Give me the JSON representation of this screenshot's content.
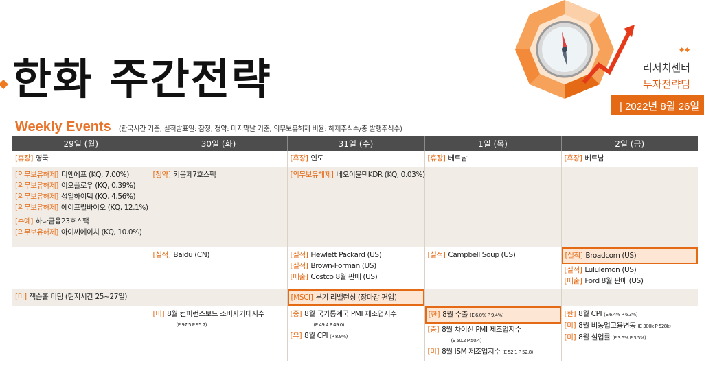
{
  "header": {
    "title": "한화 주간전략",
    "org_line1": "리서치센터",
    "org_line2": "투자전략팀",
    "date": "| 2022년 8월 26일",
    "section_title": "Weekly Events",
    "section_note": "(한국시간 기준, 실적발표일: 잠정, 청약: 마지막날 기준, 의무보유해제 비율: 해제주식수/총 발행주식수)",
    "accent": "#e46a15"
  },
  "days": [
    "29일 (월)",
    "30일 (화)",
    "31일 (수)",
    "1일 (목)",
    "2일 (금)"
  ],
  "rows": {
    "holiday": {
      "mon": {
        "tag": "[휴장]",
        "text": "영국"
      },
      "wed": {
        "tag": "[휴장]",
        "text": "인도"
      },
      "thu": {
        "tag": "[휴장]",
        "text": "베트남"
      },
      "fri": {
        "tag": "[휴장]",
        "text": "베트남"
      }
    },
    "ipo": {
      "mon": [
        {
          "tag": "[의무보유해제]",
          "text": "디앤에프 (KQ, 7.00%)"
        },
        {
          "tag": "[의무보유해제]",
          "text": "이오플로우 (KQ, 0.39%)"
        },
        {
          "tag": "[의무보유해제]",
          "text": "성일하이텍 (KQ, 4.56%)"
        },
        {
          "tag": "[의무보유해제]",
          "text": "에이프릴바이오 (KQ, 12.1%)"
        },
        {
          "tag": "[수예]",
          "text": "하나금융23호스팩"
        },
        {
          "tag": "[의무보유해제]",
          "text": "아이씨에이치 (KQ, 10.0%)"
        }
      ],
      "tue": {
        "tag": "[청약]",
        "text": "키움제7호스팩"
      },
      "wed": {
        "tag": "[의무보유해제]",
        "text": "네오이뮨텍KDR (KQ, 0.03%)"
      }
    },
    "earnings": {
      "tue": {
        "tag": "[실적]",
        "text": "Baidu (CN)"
      },
      "wed": [
        {
          "tag": "[실적]",
          "text": "Hewlett Packard (US)"
        },
        {
          "tag": "[실적]",
          "text": "Brown-Forman (US)"
        },
        {
          "tag": "[매출]",
          "text": "Costco 8월 판매 (US)"
        }
      ],
      "thu": {
        "tag": "[실적]",
        "text": "Campbell Soup (US)"
      },
      "fri": [
        {
          "tag": "[실적]",
          "text": "Broadcom (US)"
        },
        {
          "tag": "[실적]",
          "text": "Lululemon (US)"
        },
        {
          "tag": "[매출]",
          "text": "Ford 8월 판매 (US)"
        }
      ]
    },
    "events": {
      "mon": {
        "tag": "[미]",
        "text": "잭슨홀 미팅 (현지시간 25~27일)"
      },
      "wed": {
        "tag": "[MSCI]",
        "text": "분기 리밸런싱 (장마감 편입)"
      }
    },
    "macro": {
      "tue": [
        {
          "tag": "[미]",
          "text": "8월 컨퍼런스보드 소비자기대지수",
          "detail": "(E 97.5 P 95.7)"
        }
      ],
      "wed": [
        {
          "tag": "[중]",
          "text": "8월 국가통계국 PMI 제조업지수",
          "detail": "(E 49.4 P 49.0)"
        },
        {
          "tag": "[유]",
          "text": "8월 CPI",
          "detail": "(P 8.9%)"
        }
      ],
      "thu": [
        {
          "tag": "[한]",
          "text": "8월 수출",
          "detail": "(E 6.0% P 9.4%)"
        },
        {
          "tag": "[중]",
          "text": "8월 차이신 PMI 제조업지수",
          "detail": "(E 50.2 P 50.4)"
        },
        {
          "tag": "[미]",
          "text": "8월 ISM 제조업지수",
          "detail": "(E 52.1 P 52.8)"
        }
      ],
      "fri": [
        {
          "tag": "[한]",
          "text": "8월 CPI",
          "detail": "(E 6.4% P 6.3%)"
        },
        {
          "tag": "[미]",
          "text": "8월 비농업고용변동",
          "detail": "(E 300k P 528k)"
        },
        {
          "tag": "[미]",
          "text": "8월 실업률",
          "detail": "(E 3.5% P 3.5%)"
        }
      ]
    }
  }
}
